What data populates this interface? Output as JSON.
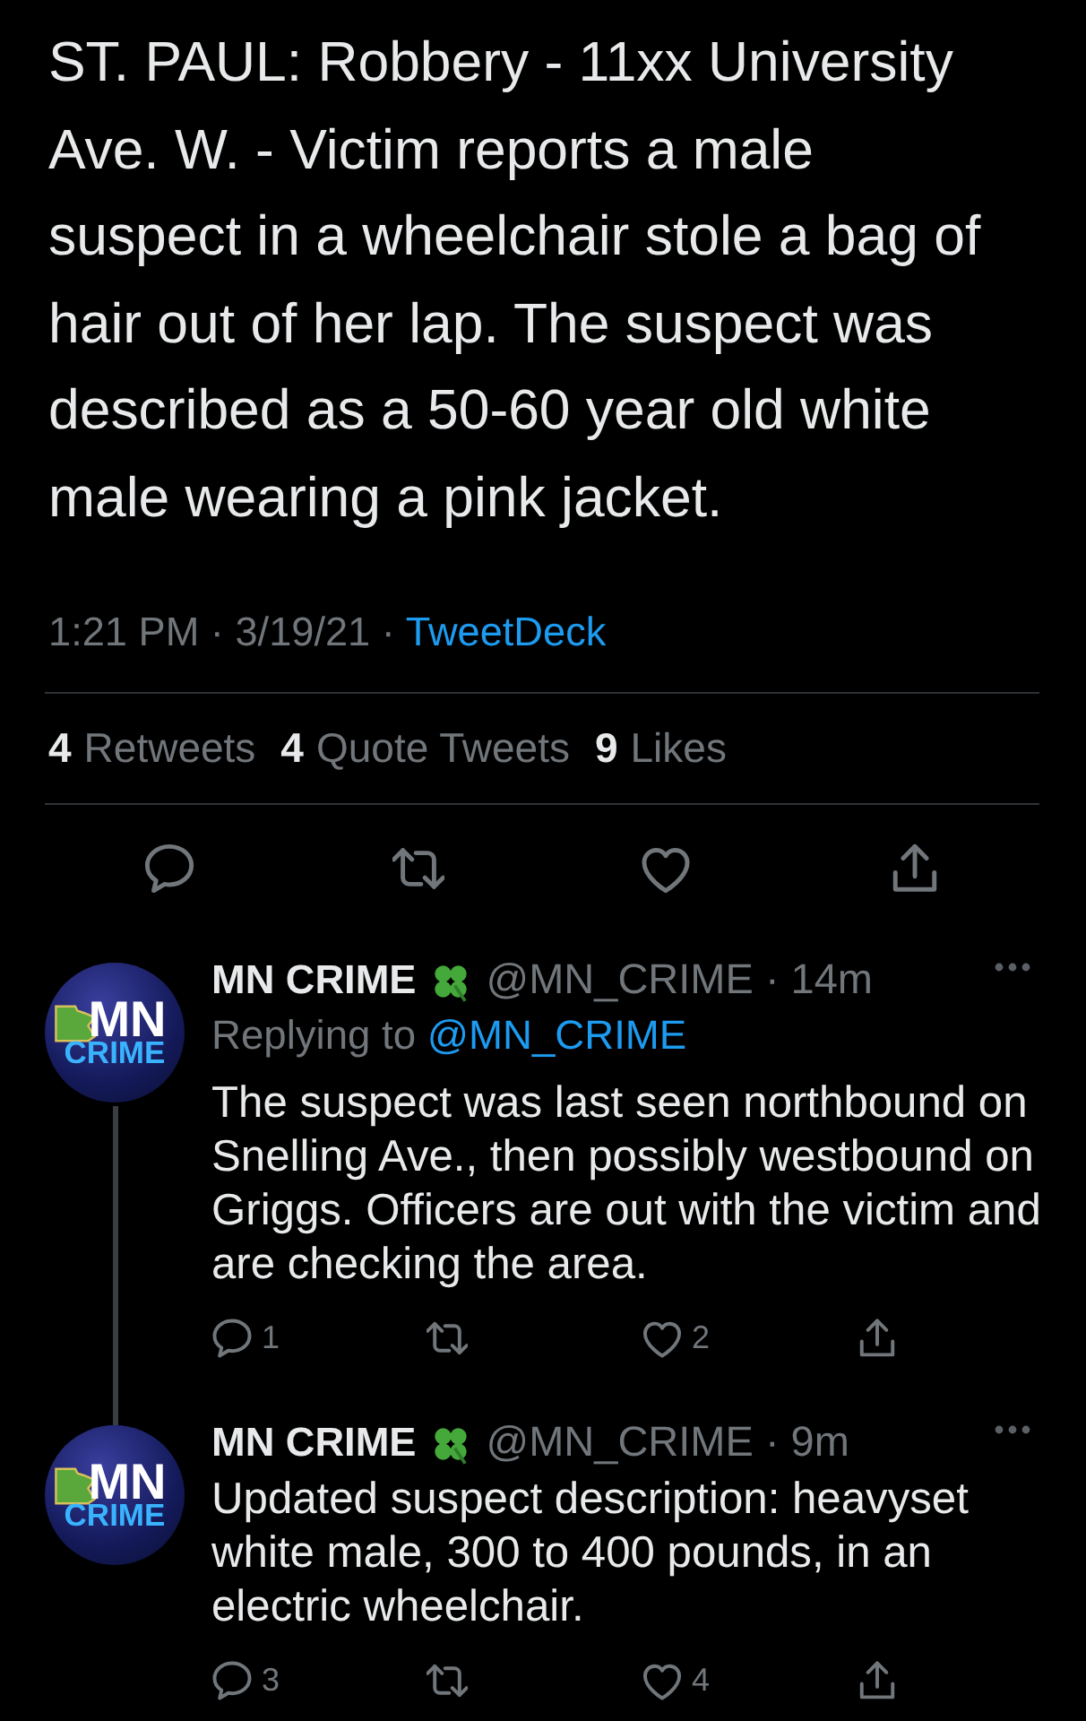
{
  "tweet": {
    "text": "ST. PAUL: Robbery - 11xx University Ave. W. - Victim reports a male suspect in a wheelchair stole a bag of hair out of her lap. The suspect was described as a 50-60 year old white male wearing a pink jacket.",
    "timestamp": "1:21 PM · 3/19/21 ·",
    "source": "TweetDeck",
    "stats": [
      {
        "count": "4",
        "label": "Retweets"
      },
      {
        "count": "4",
        "label": "Quote Tweets"
      },
      {
        "count": "9",
        "label": "Likes"
      }
    ],
    "actions": [
      {
        "kind": "reply"
      },
      {
        "kind": "retweet"
      },
      {
        "kind": "like"
      },
      {
        "kind": "share"
      }
    ]
  },
  "replies": [
    {
      "avatar": {
        "lines": [
          "MN",
          "CRIME"
        ]
      },
      "name": "MN CRIME",
      "handle_time": "@MN_CRIME · 14m",
      "replying_label": "Replying to",
      "replying_to": "@MN_CRIME",
      "thread_line": true,
      "text": "The suspect was last seen northbound on Snelling Ave., then possibly westbound on Griggs. Officers are out with the victim and are checking the area.",
      "actions": [
        {
          "kind": "reply",
          "count": "1"
        },
        {
          "kind": "retweet"
        },
        {
          "kind": "like",
          "count": "2"
        },
        {
          "kind": "share"
        }
      ]
    },
    {
      "avatar": {
        "lines": [
          "MN",
          "CRIME"
        ]
      },
      "name": "MN CRIME",
      "handle_time": "@MN_CRIME · 9m",
      "thread_line": false,
      "text": "Updated suspect description: heavyset white male, 300 to 400 pounds, in an electric wheelchair.",
      "actions": [
        {
          "kind": "reply",
          "count": "3"
        },
        {
          "kind": "retweet"
        },
        {
          "kind": "like",
          "count": "4"
        },
        {
          "kind": "share"
        }
      ]
    }
  ]
}
